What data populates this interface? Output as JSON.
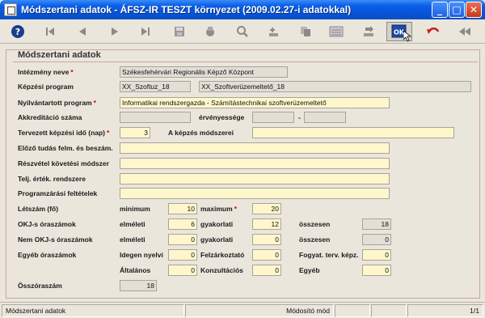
{
  "window": {
    "title": "Módszertani adatok - ÁFSZ-IR TESZT környezet (2009.02.27-i adatokkal)"
  },
  "titlebar_buttons": {
    "minimize": "_",
    "maximize": "□",
    "close": "✕"
  },
  "toolbar": {
    "buttons": [
      {
        "name": "help-icon"
      },
      {
        "name": "first-record-icon"
      },
      {
        "name": "previous-record-icon"
      },
      {
        "name": "next-record-icon"
      },
      {
        "name": "last-record-icon"
      },
      {
        "name": "save-icon"
      },
      {
        "name": "print-icon"
      },
      {
        "name": "search-icon"
      },
      {
        "name": "new-record-icon"
      },
      {
        "name": "copy-icon"
      },
      {
        "name": "list-icon"
      },
      {
        "name": "import-icon"
      },
      {
        "name": "ok-icon"
      },
      {
        "name": "undo-icon"
      },
      {
        "name": "exit-icon"
      }
    ],
    "ok_label": "OK"
  },
  "form": {
    "title": "Módszertani adatok",
    "intezmeny": {
      "label": "Intézmény neve",
      "value": "Székesfehérvári Regionális Képző Központ"
    },
    "kepzesi_program": {
      "label": "Képzési program",
      "code": "XX_Szoftuz_18",
      "name": "XX_Szoftverüzemeltető_18"
    },
    "nyilv_program": {
      "label": "Nyilvántartott program",
      "value": "Informatikai rendszergazda - Számítástechnikai szoftverüzemeltető"
    },
    "akkreditacio": {
      "label": "Akkreditáció száma",
      "value": "",
      "ervenyesseg_label": "érvényessége",
      "from": "",
      "dash": "-",
      "to": ""
    },
    "kepzesi_ido": {
      "label": "Tervezett képzési idő (nap)",
      "value": "3",
      "modszer_label": "A képzés módszerei",
      "modszer_value": ""
    },
    "elozo_tudas": {
      "label": "Előző tudás felm. és beszám.",
      "value": ""
    },
    "reszvetel": {
      "label": "Részvétel követési módszer",
      "value": ""
    },
    "telj_ertek": {
      "label": "Telj. érték. rendszere",
      "value": ""
    },
    "programzaras": {
      "label": "Programzárási feltételek",
      "value": ""
    },
    "letszam": {
      "label": "Létszám (fő)",
      "min_label": "minimum",
      "min_value": "10",
      "max_label": "maximum",
      "max_value": "20"
    },
    "okj": {
      "label": "OKJ-s óraszámok",
      "elm_label": "elméleti",
      "elm_value": "6",
      "gyak_label": "gyakorlati",
      "gyak_value": "12",
      "ossz_label": "összesen",
      "ossz_value": "18"
    },
    "nem_okj": {
      "label": "Nem OKJ-s óraszámok",
      "elm_label": "elméleti",
      "elm_value": "0",
      "gyak_label": "gyakorlati",
      "gyak_value": "0",
      "ossz_label": "összesen",
      "ossz_value": "0"
    },
    "egyeb": {
      "label": "Egyéb óraszámok",
      "idegen_label": "Idegen nyelvi",
      "idegen_value": "0",
      "felzark_label": "Felzárkoztató",
      "felzark_value": "0",
      "fogyat_label": "Fogyat. terv. képz.",
      "fogyat_value": "0",
      "altalanos_label": "Általános",
      "altalanos_value": "0",
      "konzult_label": "Konzultációs",
      "konzult_value": "0",
      "egyeb_label": "Egyéb",
      "egyeb_value": "0"
    },
    "osszoraszam": {
      "label": "Összóraszám",
      "value": "18"
    }
  },
  "statusbar": {
    "left": "Módszertani adatok",
    "mode": "Módosító mód",
    "page": "1/1"
  },
  "required_marker": "*"
}
